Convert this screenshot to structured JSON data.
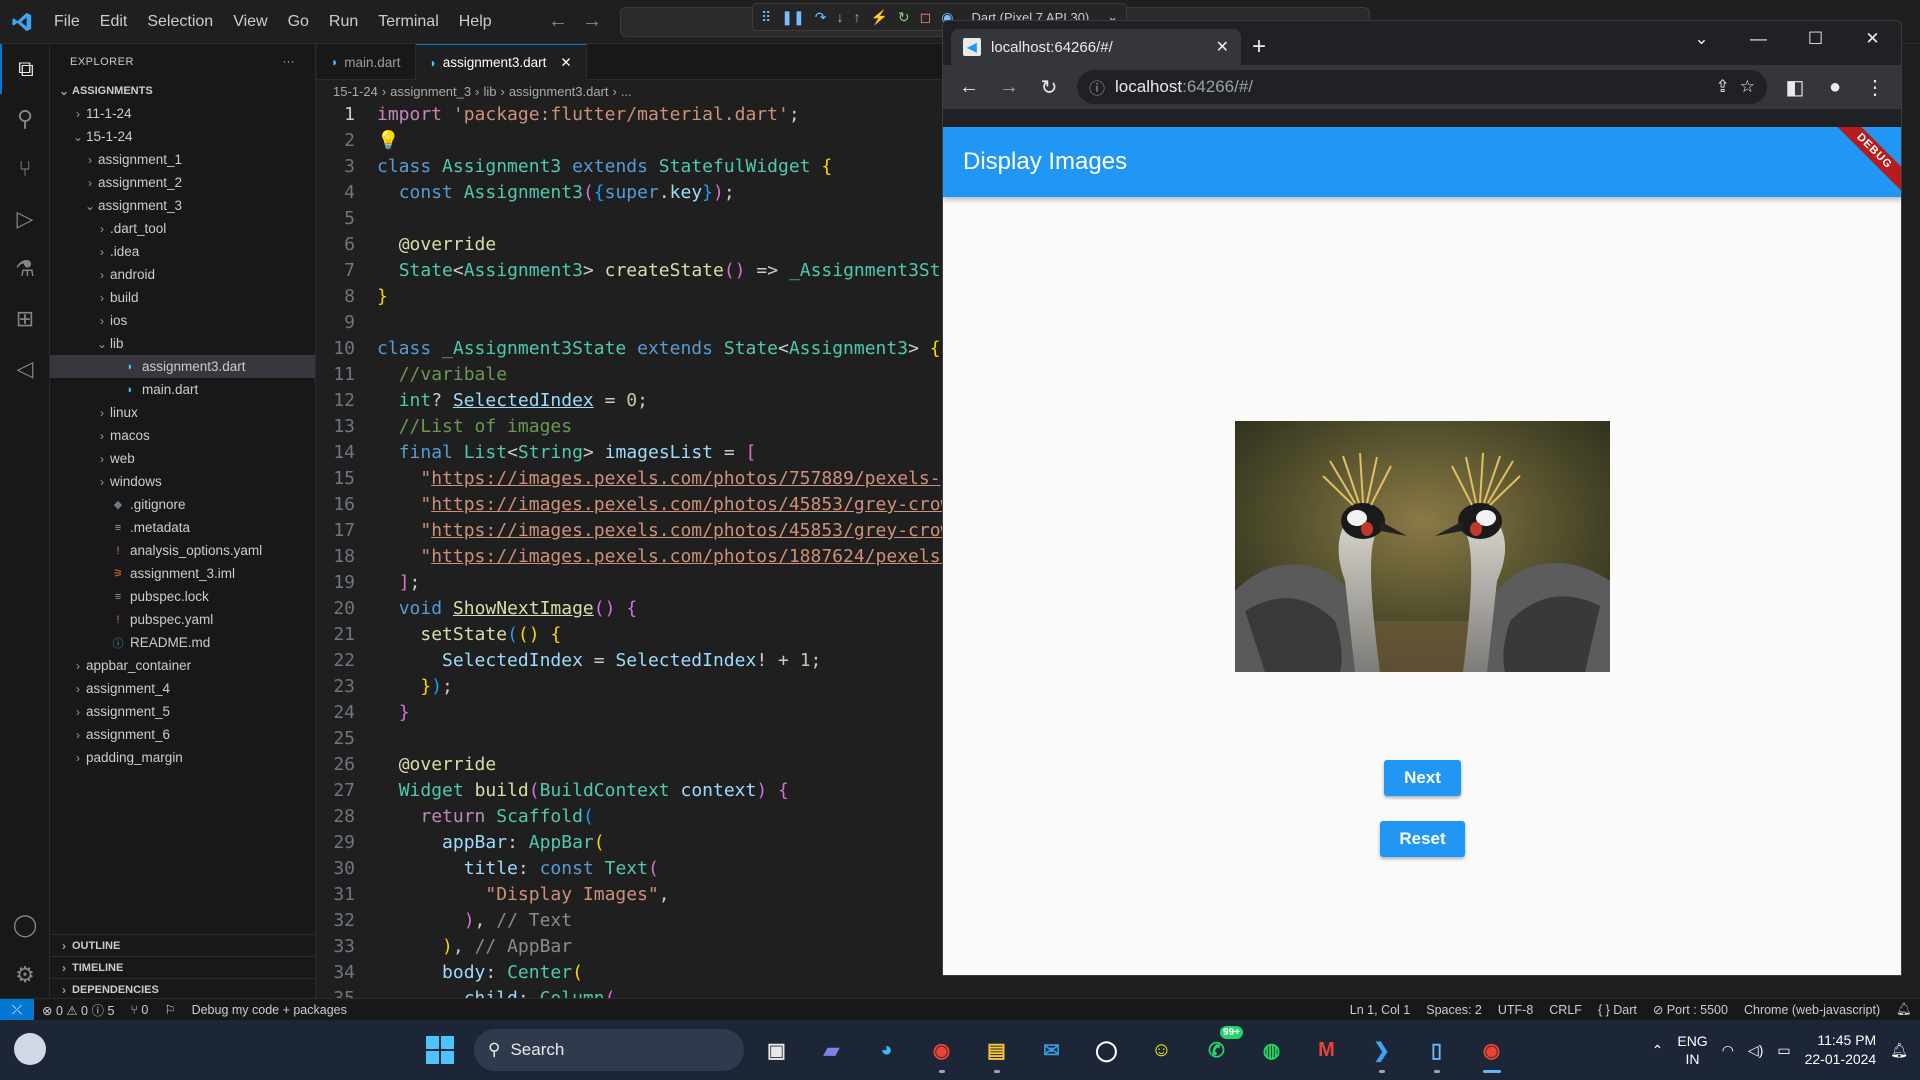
{
  "menu": [
    "File",
    "Edit",
    "Selection",
    "View",
    "Go",
    "Run",
    "Terminal",
    "Help"
  ],
  "debug_device": "Dart (Pixel 7 API 30)",
  "explorer": {
    "header": "EXPLORER",
    "section": "ASSIGNMENTS",
    "items": [
      {
        "label": "11-1-24",
        "indent": 1,
        "tw": "›",
        "icon": ""
      },
      {
        "label": "15-1-24",
        "indent": 1,
        "tw": "⌄",
        "icon": ""
      },
      {
        "label": "assignment_1",
        "indent": 2,
        "tw": "›",
        "icon": ""
      },
      {
        "label": "assignment_2",
        "indent": 2,
        "tw": "›",
        "icon": ""
      },
      {
        "label": "assignment_3",
        "indent": 2,
        "tw": "⌄",
        "icon": ""
      },
      {
        "label": ".dart_tool",
        "indent": 3,
        "tw": "›",
        "icon": ""
      },
      {
        "label": ".idea",
        "indent": 3,
        "tw": "›",
        "icon": ""
      },
      {
        "label": "android",
        "indent": 3,
        "tw": "›",
        "icon": ""
      },
      {
        "label": "build",
        "indent": 3,
        "tw": "›",
        "icon": ""
      },
      {
        "label": "ios",
        "indent": 3,
        "tw": "›",
        "icon": ""
      },
      {
        "label": "lib",
        "indent": 3,
        "tw": "⌄",
        "icon": ""
      },
      {
        "label": "assignment3.dart",
        "indent": 4,
        "tw": "",
        "icon": "dart",
        "selected": true
      },
      {
        "label": "main.dart",
        "indent": 4,
        "tw": "",
        "icon": "dart"
      },
      {
        "label": "linux",
        "indent": 3,
        "tw": "›",
        "icon": ""
      },
      {
        "label": "macos",
        "indent": 3,
        "tw": "›",
        "icon": ""
      },
      {
        "label": "web",
        "indent": 3,
        "tw": "›",
        "icon": ""
      },
      {
        "label": "windows",
        "indent": 3,
        "tw": "›",
        "icon": ""
      },
      {
        "label": ".gitignore",
        "indent": 3,
        "tw": "",
        "icon": "git"
      },
      {
        "label": ".metadata",
        "indent": 3,
        "tw": "",
        "icon": "lines"
      },
      {
        "label": "analysis_options.yaml",
        "indent": 3,
        "tw": "",
        "icon": "yaml"
      },
      {
        "label": "assignment_3.iml",
        "indent": 3,
        "tw": "",
        "icon": "rss"
      },
      {
        "label": "pubspec.lock",
        "indent": 3,
        "tw": "",
        "icon": "lines"
      },
      {
        "label": "pubspec.yaml",
        "indent": 3,
        "tw": "",
        "icon": "yaml"
      },
      {
        "label": "README.md",
        "indent": 3,
        "tw": "",
        "icon": "info"
      },
      {
        "label": "appbar_container",
        "indent": 1,
        "tw": "›",
        "icon": ""
      },
      {
        "label": "assignment_4",
        "indent": 1,
        "tw": "›",
        "icon": ""
      },
      {
        "label": "assignment_5",
        "indent": 1,
        "tw": "›",
        "icon": ""
      },
      {
        "label": "assignment_6",
        "indent": 1,
        "tw": "›",
        "icon": ""
      },
      {
        "label": "padding_margin",
        "indent": 1,
        "tw": "›",
        "icon": ""
      }
    ],
    "bottom_sections": [
      "OUTLINE",
      "TIMELINE",
      "DEPENDENCIES"
    ]
  },
  "editor": {
    "tabs": [
      {
        "label": "main.dart",
        "active": false
      },
      {
        "label": "assignment3.dart",
        "active": true
      }
    ],
    "breadcrumb": [
      "15-1-24",
      "assignment_3",
      "lib",
      "assignment3.dart",
      "..."
    ]
  },
  "browser": {
    "tab_title": "localhost:64266/#/",
    "url_host": "localhost",
    "url_rest": ":64266/#/"
  },
  "app": {
    "title": "Display Images",
    "debug_banner": "DEBUG",
    "next_label": "Next",
    "reset_label": "Reset"
  },
  "statusbar": {
    "problems": "⊗ 0 ⚠ 0 ⓘ 5",
    "ports": "⑂ 0",
    "debug_config": "Debug my code + packages",
    "position": "Ln 1, Col 1",
    "spaces": "Spaces: 2",
    "encoding": "UTF-8",
    "eol": "CRLF",
    "language": "{ } Dart",
    "port": "⊘ Port : 5500",
    "target": "Chrome (web-javascript)"
  },
  "taskbar": {
    "search": "Search",
    "badge": "99+",
    "lang_top": "ENG",
    "lang_bottom": "IN",
    "time": "11:45 PM",
    "date": "22-01-2024"
  },
  "colors": {
    "accent": "#0078d4",
    "flutter_blue": "#2196f3",
    "debug_red": "#b71c1c"
  }
}
